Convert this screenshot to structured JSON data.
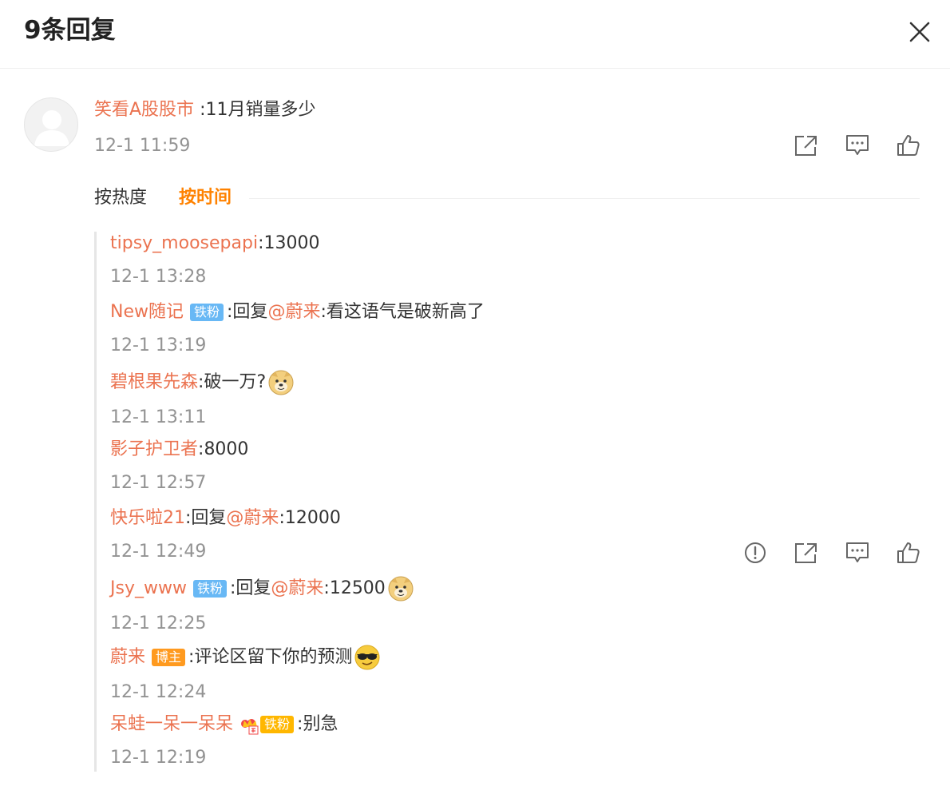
{
  "header": {
    "title": "9条回复"
  },
  "main_comment": {
    "username": "笑看A股股市",
    "text": ":11月销量多少",
    "time": "12-1 11:59"
  },
  "sort": {
    "hot": "按热度",
    "time": "按时间",
    "active": "按时间"
  },
  "replies": [
    {
      "user": "tipsy_moosepapi",
      "sep": ":",
      "text": "13000",
      "time": "12-1 13:28"
    },
    {
      "user": "New随记",
      "badge": "铁粉",
      "reply_prefix": ":回复",
      "mention": "@蔚来",
      "text": ":看这语气是破新高了",
      "time": "12-1 13:19"
    },
    {
      "user": "碧根果先森",
      "sep": ":",
      "text": "破一万?",
      "emoji": "doge-emoji",
      "time": "12-1 13:11"
    },
    {
      "user": "影子护卫者",
      "sep": ":",
      "text": "8000",
      "time": "12-1 12:57"
    },
    {
      "user": "快乐啦21",
      "reply_prefix": ":回复",
      "mention": "@蔚来",
      "text": ":12000",
      "time": "12-1 12:49"
    },
    {
      "user": "Jsy_www",
      "badge": "铁粉",
      "reply_prefix": ":回复",
      "mention": "@蔚来",
      "text": ":12500",
      "emoji": "doge-emoji",
      "time": "12-1 12:25"
    },
    {
      "user": "蔚来",
      "badge": "博主",
      "sep": ":",
      "text": "评论区留下你的预测",
      "emoji": "cool-sunglasses-emoji",
      "time": "12-1 12:24"
    },
    {
      "user": "呆蛙一呆一呆呆",
      "badge": "铁粉",
      "sep": ":",
      "text": "别急",
      "time": "12-1 12:19"
    }
  ],
  "icons": {
    "close": "close-icon",
    "share": "share-icon",
    "comment": "comment-icon",
    "like": "thumbs-up-icon",
    "report": "report-icon"
  },
  "colors": {
    "username": "#eb7350",
    "active_sort": "#ff8200",
    "time": "#939393",
    "badge_fan": "#68b8f5",
    "badge_host": "#ff9a1f"
  }
}
